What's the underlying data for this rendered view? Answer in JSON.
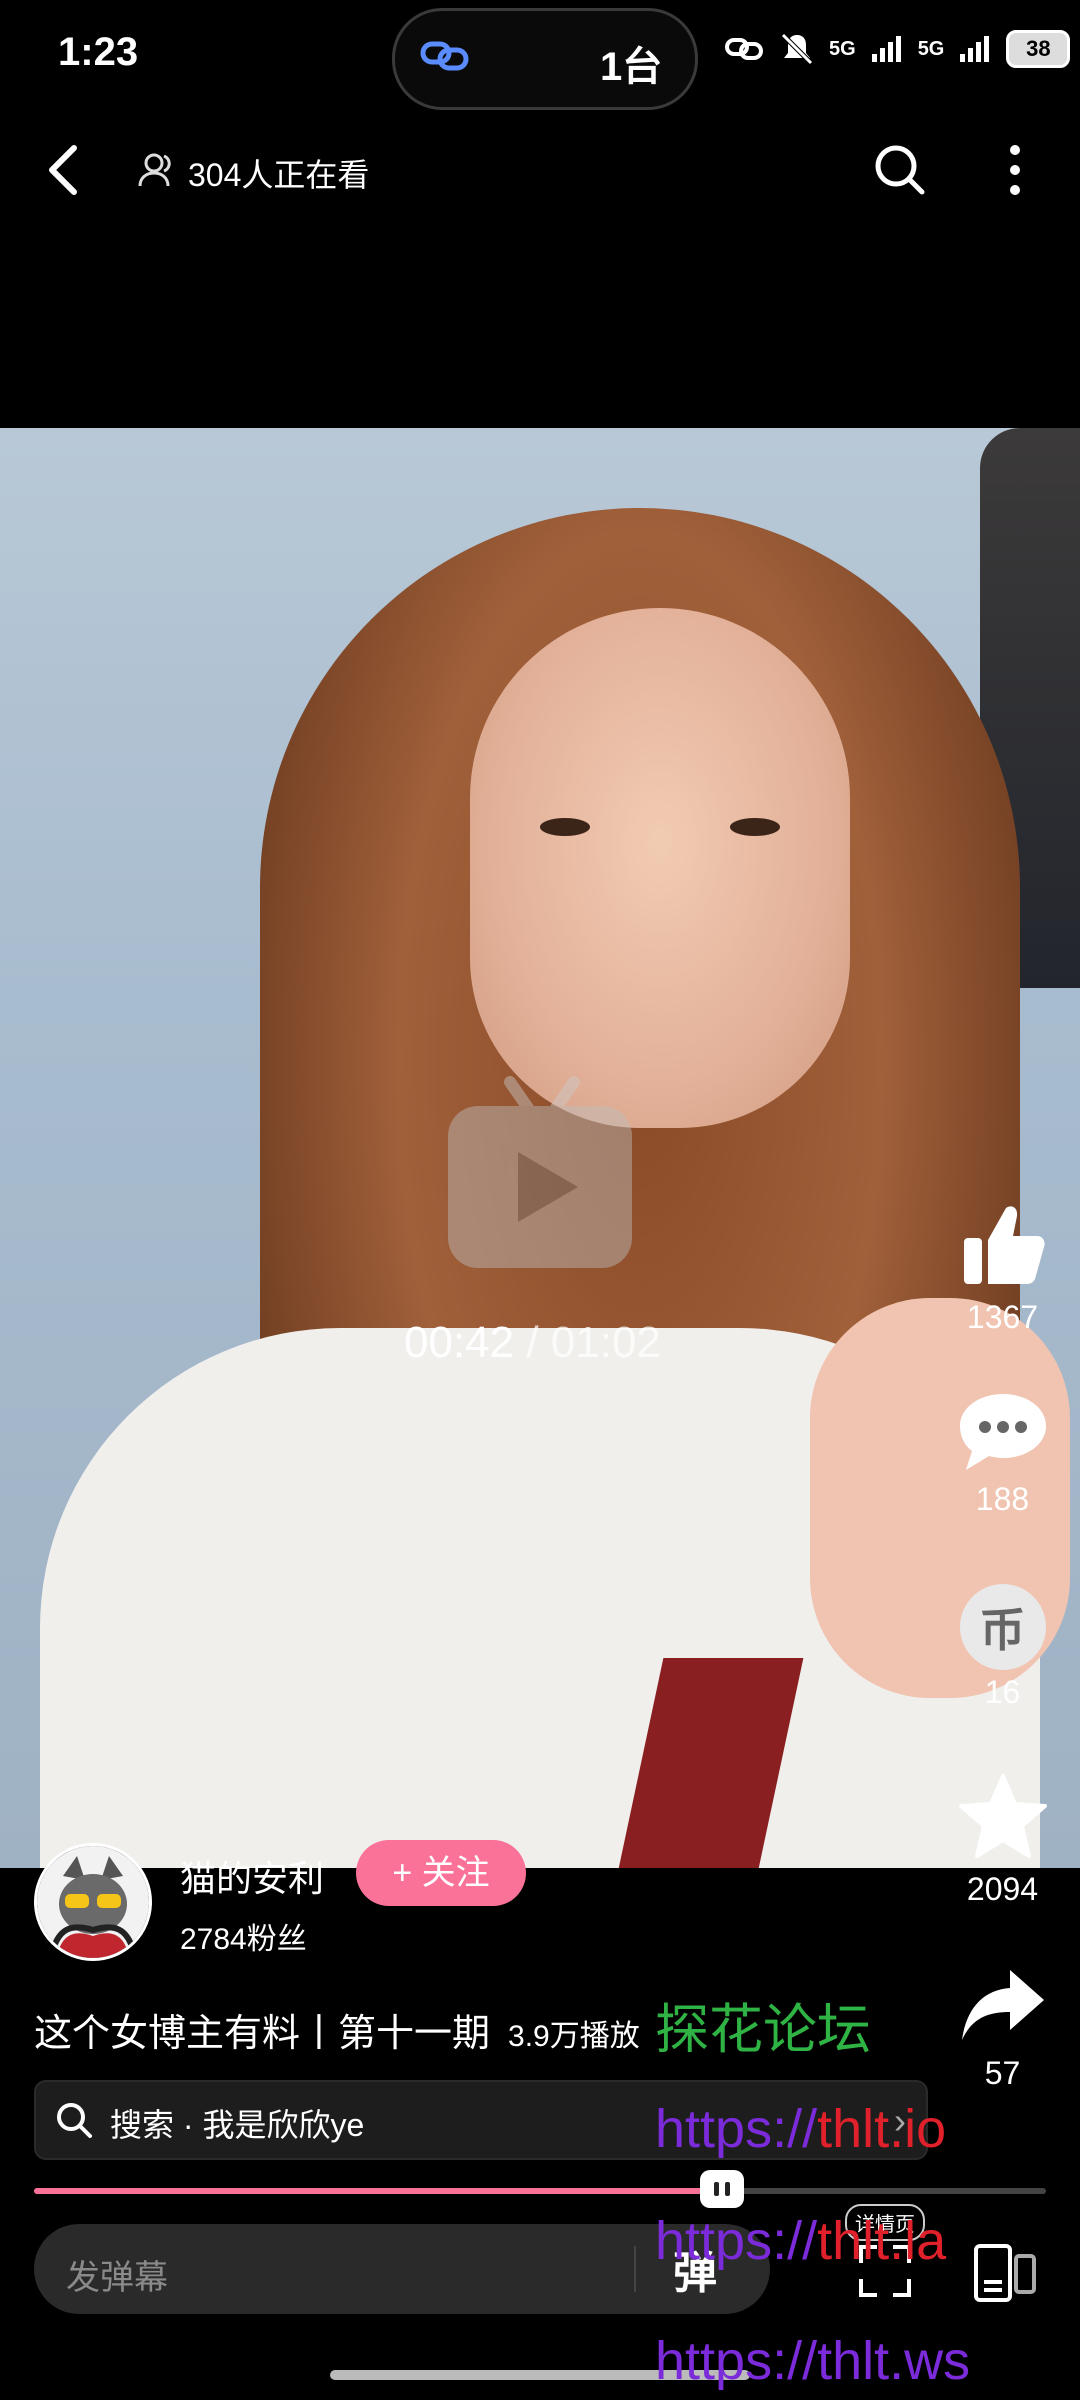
{
  "status_bar": {
    "time": "1:23",
    "island_label": "1台",
    "network_1": "5G",
    "network_2": "5G",
    "battery": "38"
  },
  "top_nav": {
    "watching": "304人正在看"
  },
  "video": {
    "current_time": "00:42",
    "separator": " / ",
    "total_time": "01:02",
    "progress": 0.68
  },
  "actions": {
    "like_count": "1367",
    "comment_count": "188",
    "coin_glyph": "币",
    "coin_count": "16",
    "favorite_count": "2094",
    "share_count": "57"
  },
  "author": {
    "name": "猫的安利",
    "follow_label": "+ 关注",
    "fans": "2784粉丝"
  },
  "video_info": {
    "title": "这个女博主有料丨第十一期",
    "plays": "3.9万播放"
  },
  "search": {
    "text": "搜索 · 我是欣欣ye"
  },
  "bottom": {
    "danmaku_placeholder": "发弹幕",
    "danmaku_toggle": "弹",
    "detail_label": "详情页"
  },
  "watermark": {
    "forum": "探花论坛",
    "url_1_a": "https://",
    "url_1_b": "thlt.io",
    "url_2_a": "https://",
    "url_2_b": "thlt.la",
    "url_3": "https://thlt.ws"
  },
  "colors": {
    "accent": "#fb7299",
    "watermark_green": "#2fb344",
    "watermark_purple": "#7b2bd9",
    "watermark_red": "#e0202a"
  }
}
